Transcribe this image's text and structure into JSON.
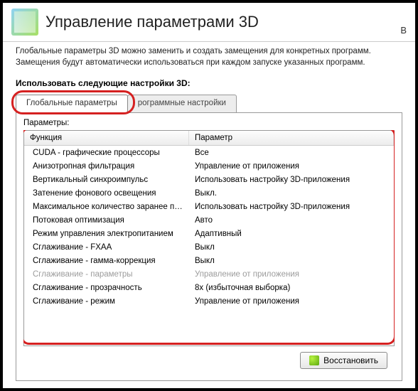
{
  "title": "Управление параметрами 3D",
  "title_cut": "В",
  "description": "Глобальные параметры 3D можно заменить и создать замещения для конкретных программ. Замещения будут автоматически использоваться при каждом запуске указанных программ.",
  "section_label": "Использовать следующие настройки 3D:",
  "tabs": {
    "global": "Глобальные параметры",
    "program": "рограммные настройки"
  },
  "params_label": "Параметры:",
  "columns": {
    "func": "Функция",
    "param": "Параметр"
  },
  "rows": [
    {
      "func": "CUDA - графические процессоры",
      "param": "Все",
      "disabled": false
    },
    {
      "func": "Анизотропная фильтрация",
      "param": "Управление от приложения",
      "disabled": false
    },
    {
      "func": "Вертикальный синхроимпульс",
      "param": "Использовать настройку 3D-приложения",
      "disabled": false
    },
    {
      "func": "Затенение фонового освещения",
      "param": "Выкл.",
      "disabled": false
    },
    {
      "func": "Максимальное количество заранее под…",
      "param": "Использовать настройку 3D-приложения",
      "disabled": false
    },
    {
      "func": "Потоковая оптимизация",
      "param": "Авто",
      "disabled": false
    },
    {
      "func": "Режим управления электропитанием",
      "param": "Адаптивный",
      "disabled": false
    },
    {
      "func": "Сглаживание - FXAA",
      "param": "Выкл",
      "disabled": false
    },
    {
      "func": "Сглаживание - гамма-коррекция",
      "param": "Выкл",
      "disabled": false
    },
    {
      "func": "Сглаживание - параметры",
      "param": "Управление от приложения",
      "disabled": true
    },
    {
      "func": "Сглаживание - прозрачность",
      "param": "8x (избыточная выборка)",
      "disabled": false
    },
    {
      "func": "Сглаживание - режим",
      "param": "Управление от приложения",
      "disabled": false
    }
  ],
  "restore_label": "Восстановить"
}
